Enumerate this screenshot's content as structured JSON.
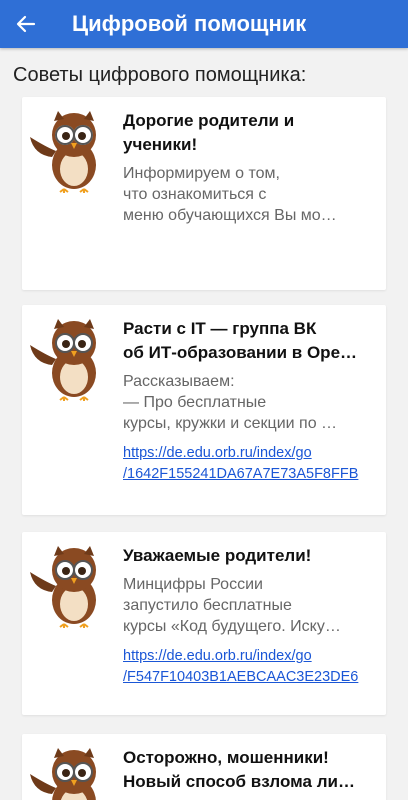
{
  "appbar": {
    "back_icon": "arrow-left-icon",
    "title": "Цифровой помощник",
    "color": "#2f6fd6"
  },
  "section": {
    "title": "Советы цифрового помощника:"
  },
  "cards": [
    {
      "title": [
        "Дорогие родители и",
        "ученики!"
      ],
      "text": [
        "Информируем о том,",
        "что ознакомиться с",
        "меню обучающихся Вы мо…"
      ],
      "link": []
    },
    {
      "title": [
        "Расти с IT — группа ВК",
        "об ИТ-образовании в Оре…"
      ],
      "text": [
        "Рассказываем:",
        "— Про бесплатные",
        "курсы, кружки и секции по …"
      ],
      "link": [
        "https://de.edu.orb.ru/index/go",
        "/1642F155241DA67A7E73A5F8FFB"
      ]
    },
    {
      "title": [
        "Уважаемые родители!"
      ],
      "text": [
        "Минцифры России",
        "запустило бесплатные",
        "курсы «Код будущего. Иску…"
      ],
      "link": [
        "https://de.edu.orb.ru/index/go",
        "/F547F10403B1AEBCAAC3E23DE6"
      ]
    },
    {
      "title": [
        "Осторожно, мошенники!",
        "Новый способ взлома ли…"
      ],
      "text": [],
      "link": []
    }
  ]
}
